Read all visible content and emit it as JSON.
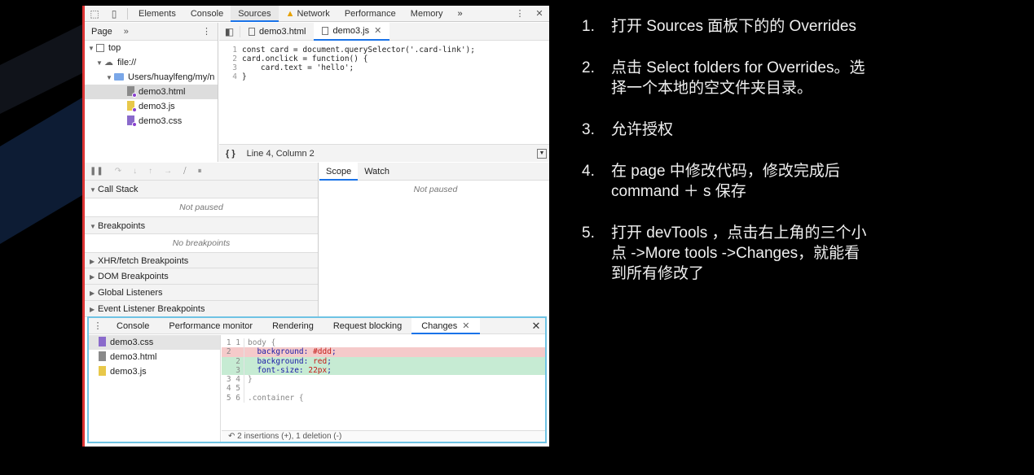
{
  "devtools": {
    "main_tabs": [
      "Elements",
      "Console",
      "Sources",
      "Network",
      "Performance",
      "Memory"
    ],
    "active_tab": "Sources",
    "more_tabs_icon": "double-chevron-right-icon",
    "navigator": {
      "tab_label": "Page",
      "tree": [
        "top",
        "file://",
        "Users/huaylfeng/my/n",
        "demo3.html",
        "demo3.js",
        "demo3.css"
      ]
    },
    "editor": {
      "tabs": [
        "demo3.html",
        "demo3.js"
      ],
      "active_tab": "demo3.js",
      "code_lines": [
        {
          "n": "1",
          "text": "const card = document.querySelector('.card-link');"
        },
        {
          "n": "2",
          "text": "card.onclick = function() {"
        },
        {
          "n": "3",
          "text": "    card.text = 'hello';"
        },
        {
          "n": "4",
          "text": "}"
        }
      ],
      "status_braces": "{ }",
      "status_position": "Line 4, Column 2"
    },
    "debugger": {
      "call_stack": "Call Stack",
      "not_paused": "Not paused",
      "breakpoints": "Breakpoints",
      "no_breakpoints": "No breakpoints",
      "sections": [
        "XHR/fetch Breakpoints",
        "DOM Breakpoints",
        "Global Listeners",
        "Event Listener Breakpoints"
      ]
    },
    "scope": {
      "tabs": [
        "Scope",
        "Watch"
      ],
      "not_paused": "Not paused"
    },
    "drawer": {
      "tabs": [
        "Console",
        "Performance monitor",
        "Rendering",
        "Request blocking",
        "Changes"
      ],
      "active_tab": "Changes",
      "files": [
        "demo3.css",
        "demo3.html",
        "demo3.js"
      ],
      "diff": [
        {
          "g": "1 1",
          "type": "ctx",
          "text": "body {"
        },
        {
          "g": "2  ",
          "type": "del",
          "text": "  background: ",
          "val": "#ddd",
          "tail": ";"
        },
        {
          "g": "  2",
          "type": "ins",
          "text": "  background: ",
          "val": "red",
          "tail": ";"
        },
        {
          "g": "  3",
          "type": "ins",
          "text": "  font-size: ",
          "val": "22px",
          "tail": ";"
        },
        {
          "g": "3 4",
          "type": "ctx",
          "text": "}"
        },
        {
          "g": "4 5",
          "type": "ctx",
          "text": ""
        },
        {
          "g": "5 6",
          "type": "ctx",
          "text": ".container {"
        }
      ],
      "summary": "2 insertions (+), 1 deletion (-)"
    }
  },
  "instructions": [
    {
      "num": "1.",
      "lines": [
        "打开 Sources 面板下的的 Overrides"
      ]
    },
    {
      "num": "2.",
      "lines": [
        "点击 Select folders for Overrides。选",
        "择一个本地的空文件夹目录。"
      ]
    },
    {
      "num": "3.",
      "lines": [
        "允许授权"
      ]
    },
    {
      "num": "4.",
      "lines": [
        "在 page 中修改代码，修改完成后",
        "command ＋ s 保存"
      ]
    },
    {
      "num": "5.",
      "lines": [
        "打开 devTools ，点击右上角的三个小",
        "点 ->More tools ->Changes，就能看",
        "到所有修改了"
      ]
    }
  ],
  "colors": {
    "background": "#000000",
    "accent": "#1a73e8",
    "drawer_border": "#6ec3e4",
    "deletion": "#f5caca",
    "insertion": "#c6ebd3"
  }
}
